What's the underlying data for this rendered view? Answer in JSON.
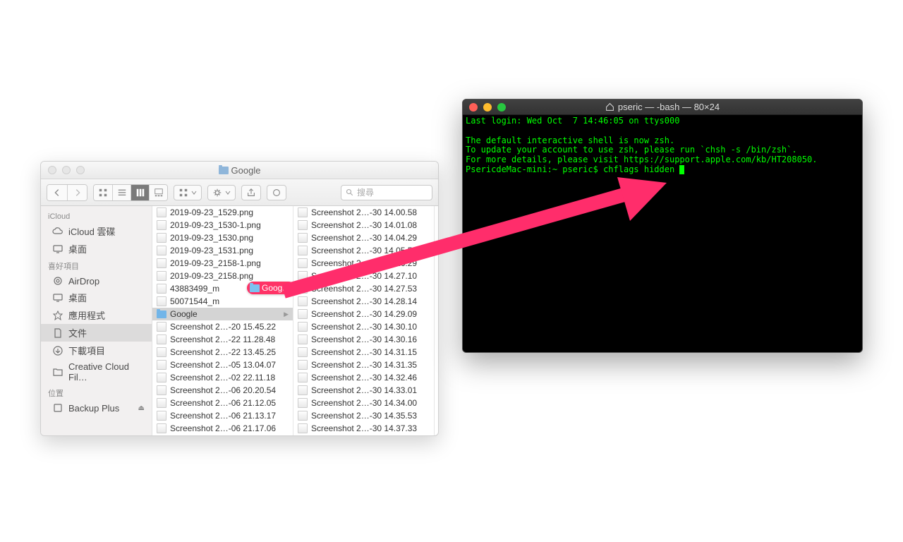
{
  "finder": {
    "title": "Google",
    "search_placeholder": "搜尋",
    "sidebar": {
      "sections": [
        {
          "heading": "iCloud",
          "items": [
            {
              "icon": "cloud",
              "label": "iCloud 雲碟"
            },
            {
              "icon": "desktop",
              "label": "桌面"
            }
          ]
        },
        {
          "heading": "喜好項目",
          "items": [
            {
              "icon": "airdrop",
              "label": "AirDrop"
            },
            {
              "icon": "desktop",
              "label": "桌面"
            },
            {
              "icon": "apps",
              "label": "應用程式"
            },
            {
              "icon": "docs",
              "label": "文件",
              "selected": true
            },
            {
              "icon": "downloads",
              "label": "下載項目"
            },
            {
              "icon": "folder",
              "label": "Creative Cloud Fil…"
            }
          ]
        },
        {
          "heading": "位置",
          "items": [
            {
              "icon": "disk",
              "label": "Backup Plus",
              "eject": true
            }
          ]
        }
      ]
    },
    "columns": [
      [
        {
          "name": "2019-09-23_1529.png",
          "type": "img"
        },
        {
          "name": "2019-09-23_1530-1.png",
          "type": "img"
        },
        {
          "name": "2019-09-23_1530.png",
          "type": "img"
        },
        {
          "name": "2019-09-23_1531.png",
          "type": "img"
        },
        {
          "name": "2019-09-23_2158-1.png",
          "type": "img"
        },
        {
          "name": "2019-09-23_2158.png",
          "type": "img"
        },
        {
          "name": "43883499_m",
          "type": "img"
        },
        {
          "name": "50071544_m",
          "type": "img"
        },
        {
          "name": "Google",
          "type": "folder",
          "selected": true
        },
        {
          "name": "Screenshot 2…-20 15.45.22",
          "type": "img"
        },
        {
          "name": "Screenshot 2…-22 11.28.48",
          "type": "img"
        },
        {
          "name": "Screenshot 2…-22 13.45.25",
          "type": "img"
        },
        {
          "name": "Screenshot 2…-05 13.04.07",
          "type": "img"
        },
        {
          "name": "Screenshot 2…-02 22.11.18",
          "type": "img"
        },
        {
          "name": "Screenshot 2…-06 20.20.54",
          "type": "img"
        },
        {
          "name": "Screenshot 2…-06 21.12.05",
          "type": "img"
        },
        {
          "name": "Screenshot 2…-06 21.13.17",
          "type": "img"
        },
        {
          "name": "Screenshot 2…-06 21.17.06",
          "type": "img"
        }
      ],
      [
        {
          "name": "Screenshot 2…-30 14.00.58",
          "type": "img"
        },
        {
          "name": "Screenshot 2…-30 14.01.08",
          "type": "img"
        },
        {
          "name": "Screenshot 2…-30 14.04.29",
          "type": "img"
        },
        {
          "name": "Screenshot 2…-30 14.05.5",
          "type": "img"
        },
        {
          "name": "Screenshot 2…-30 14.26.29",
          "type": "img"
        },
        {
          "name": "Screenshot 2…-30 14.27.10",
          "type": "img"
        },
        {
          "name": "Screenshot 2…-30 14.27.53",
          "type": "img"
        },
        {
          "name": "Screenshot 2…-30 14.28.14",
          "type": "img"
        },
        {
          "name": "Screenshot 2…-30 14.29.09",
          "type": "img"
        },
        {
          "name": "Screenshot 2…-30 14.30.10",
          "type": "img"
        },
        {
          "name": "Screenshot 2…-30 14.30.16",
          "type": "img"
        },
        {
          "name": "Screenshot 2…-30 14.31.15",
          "type": "img"
        },
        {
          "name": "Screenshot 2…-30 14.31.35",
          "type": "img"
        },
        {
          "name": "Screenshot 2…-30 14.32.46",
          "type": "img"
        },
        {
          "name": "Screenshot 2…-30 14.33.01",
          "type": "img"
        },
        {
          "name": "Screenshot 2…-30 14.34.00",
          "type": "img"
        },
        {
          "name": "Screenshot 2…-30 14.35.53",
          "type": "img"
        },
        {
          "name": "Screenshot 2…-30 14.37.33",
          "type": "img"
        }
      ]
    ]
  },
  "drag": {
    "label": "Google"
  },
  "terminal": {
    "title": "pseric — -bash — 80×24",
    "lines": [
      "Last login: Wed Oct  7 14:46:05 on ttys000",
      "",
      "The default interactive shell is now zsh.",
      "To update your account to use zsh, please run `chsh -s /bin/zsh`.",
      "For more details, please visit https://support.apple.com/kb/HT208050.",
      "PsericdeMac-mini:~ pseric$ chflags hidden "
    ]
  },
  "colors": {
    "arrow": "#ff2d6b"
  }
}
